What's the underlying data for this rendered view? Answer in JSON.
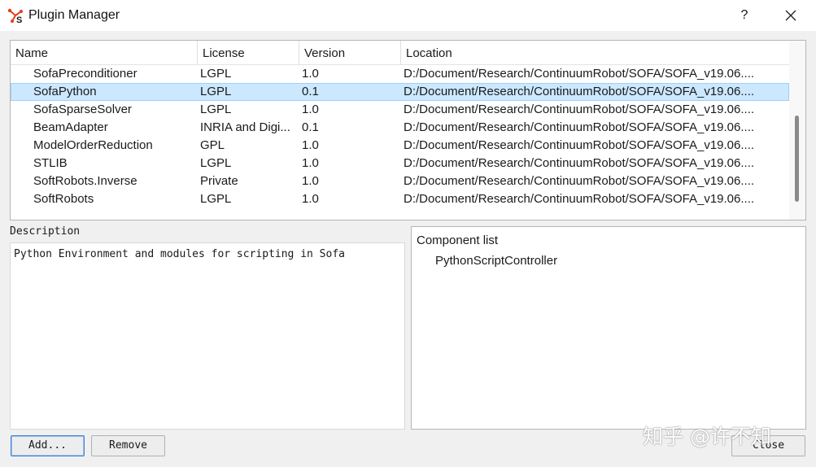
{
  "window": {
    "title": "Plugin Manager",
    "app_icon": "sofa-logo-icon",
    "help_label": "?",
    "close_icon": "close-icon"
  },
  "plugins_table": {
    "columns": [
      "Name",
      "License",
      "Version",
      "Location"
    ],
    "rows": [
      {
        "name": "SofaPreconditioner",
        "license": "LGPL",
        "version": "1.0",
        "location": "D:/Document/Research/ContinuumRobot/SOFA/SOFA_v19.06...."
      },
      {
        "name": "SofaPython",
        "license": "LGPL",
        "version": "0.1",
        "location": "D:/Document/Research/ContinuumRobot/SOFA/SOFA_v19.06...."
      },
      {
        "name": "SofaSparseSolver",
        "license": "LGPL",
        "version": "1.0",
        "location": "D:/Document/Research/ContinuumRobot/SOFA/SOFA_v19.06...."
      },
      {
        "name": "BeamAdapter",
        "license": "INRIA and Digi...",
        "version": "0.1",
        "location": "D:/Document/Research/ContinuumRobot/SOFA/SOFA_v19.06...."
      },
      {
        "name": "ModelOrderReduction",
        "license": "GPL",
        "version": "1.0",
        "location": "D:/Document/Research/ContinuumRobot/SOFA/SOFA_v19.06...."
      },
      {
        "name": "STLIB",
        "license": "LGPL",
        "version": "1.0",
        "location": "D:/Document/Research/ContinuumRobot/SOFA/SOFA_v19.06...."
      },
      {
        "name": "SoftRobots.Inverse",
        "license": "Private",
        "version": "1.0",
        "location": "D:/Document/Research/ContinuumRobot/SOFA/SOFA_v19.06...."
      },
      {
        "name": "SoftRobots",
        "license": "LGPL",
        "version": "1.0",
        "location": "D:/Document/Research/ContinuumRobot/SOFA/SOFA_v19.06...."
      }
    ],
    "selected_row": "SofaPython",
    "selection_color": "#cce8ff"
  },
  "description": {
    "label": "Description",
    "text": "Python Environment and modules for scripting in Sofa"
  },
  "components": {
    "title": "Component list",
    "items": [
      "PythonScriptController"
    ]
  },
  "buttons": {
    "add": "Add...",
    "remove": "Remove",
    "close": "Close"
  },
  "watermark": "知乎 @许不知",
  "colors": {
    "window_bg": "#f0f0f0",
    "focus_border": "#3c7fd6"
  }
}
